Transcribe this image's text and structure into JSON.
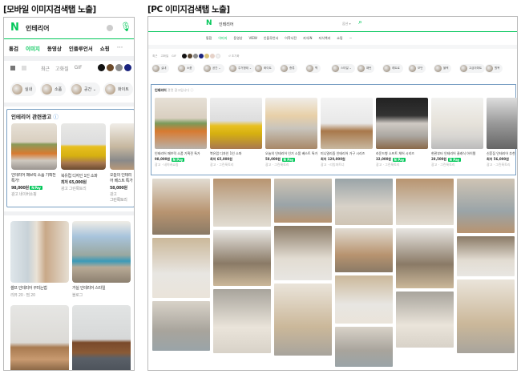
{
  "captions": {
    "mobile": "[모바일 이미지검색탭 노출]",
    "pc": "[PC 이미지검색탭 노출]"
  },
  "query": "인테리어",
  "logo": "N",
  "mobile": {
    "tabs": [
      "통검",
      "이미지",
      "동영상",
      "인플루언서",
      "쇼핑"
    ],
    "more": "···",
    "filters": [
      "최근",
      "고화질",
      "GIF"
    ],
    "colors": [
      "#111111",
      "#6b4a2b",
      "#8a8a8a",
      "#1a237e"
    ],
    "chips": [
      "실내",
      "소품",
      "공간 ⌄",
      "화이트"
    ],
    "ad_title": "인테리어 관련광고",
    "ads": [
      {
        "title": "인테리어 패브릭 소품 기획전 특가!",
        "price": "98,000원",
        "pay": "N Pay",
        "seller": "네이버쇼핑",
        "ad": "광고"
      },
      {
        "title": "북유럽 디자인 1인 소파",
        "price": "최저 65,000원",
        "seller": "그린룩토리",
        "ad": "광고"
      },
      {
        "title": "오늘의 인테리어 베스트 특가",
        "price": "58,000원",
        "seller": "그린룩토리",
        "ad": "광고"
      }
    ],
    "results": [
      {
        "title": "셀프 인테리어 꾸미는법",
        "meta": "리뷰 20 · 찜 20"
      },
      {
        "title": "거실 인테리어 스타일",
        "meta": "블로그"
      }
    ]
  },
  "pc": {
    "tabs": [
      "통합",
      "이미지",
      "동영상",
      "VIEW",
      "인플루언서",
      "어학사전",
      "지식iN",
      "지식백과",
      "쇼핑",
      "···"
    ],
    "search_option": "옵션 ▾",
    "filters": [
      "최근",
      "고화질",
      "GIF"
    ],
    "colors": [
      "#111111",
      "#5a4630",
      "#8a8a8a",
      "#1a237e",
      "#d8c27a",
      "#e6d2c8",
      "#f1f1f1"
    ],
    "filter_reset": "↺ 초기화",
    "chips": [
      "실내",
      "소품",
      "공간 ⌄",
      "주거형태 ⌄",
      "화이트",
      "종류",
      "벽",
      "스타일 ⌄",
      "패턴",
      "레트로",
      "모던",
      "블랙",
      "고급아파트",
      "원목"
    ],
    "ad_title": "인테리어",
    "ad_sub": "관련 광고입니다 ⓘ",
    "ads": [
      {
        "title": "인테리어 패브릭 소품 기획전 특가",
        "price": "98,000원",
        "pay": "N Pay",
        "seller": "광고 · 네이버쇼핑"
      },
      {
        "title": "북유럽 디자인 1인 소파",
        "price": "최저 65,000원",
        "seller": "광고 · 그린룩토리"
      },
      {
        "title": "오늘의 인테리어 인기 소품 베스트 특가",
        "price": "58,000원",
        "pay": "N Pay",
        "seller": "광고 · 그린룩토리"
      },
      {
        "title": "미니멀리즘 인테리어 가구 시리즈",
        "price": "최저 120,000원",
        "seller": "광고 · 리빙파트너"
      },
      {
        "title": "라운드형 소프트 체어 시리즈",
        "price": "32,000원",
        "pay": "N Pay",
        "seller": "광고 · 그린룩토리"
      },
      {
        "title": "현관부터 인테리어 클래식 아이템",
        "price": "28,500원",
        "pay": "N Pay",
        "seller": "광고 · 그린룩토리"
      },
      {
        "title": "신혼집 인테리어 추천",
        "price": "최저 56,000원",
        "seller": "광고 · 그린룩토리"
      }
    ]
  }
}
